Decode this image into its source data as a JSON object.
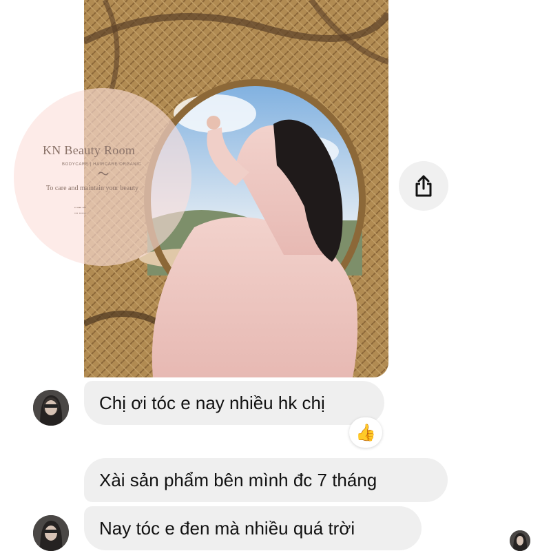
{
  "watermark": {
    "title": "KN Beauty Room",
    "subtitle": "BODYCARE | HAIRCARE ORGANIC",
    "tagline": "To care and maintain your beauty"
  },
  "messages": [
    {
      "text": "Chị ơi tóc e nay nhiều hk chị"
    },
    {
      "text": "Xài sản phẩm bên mình đc 7 tháng"
    },
    {
      "text": "Nay tóc e đen mà nhiều quá trời"
    }
  ],
  "reaction": {
    "emoji": "👍",
    "icon": "thumbs-up-icon"
  },
  "icons": {
    "share": "share-icon"
  },
  "colors": {
    "bubble": "#efefef",
    "text": "#111111",
    "watermark": "#fcdeda"
  }
}
